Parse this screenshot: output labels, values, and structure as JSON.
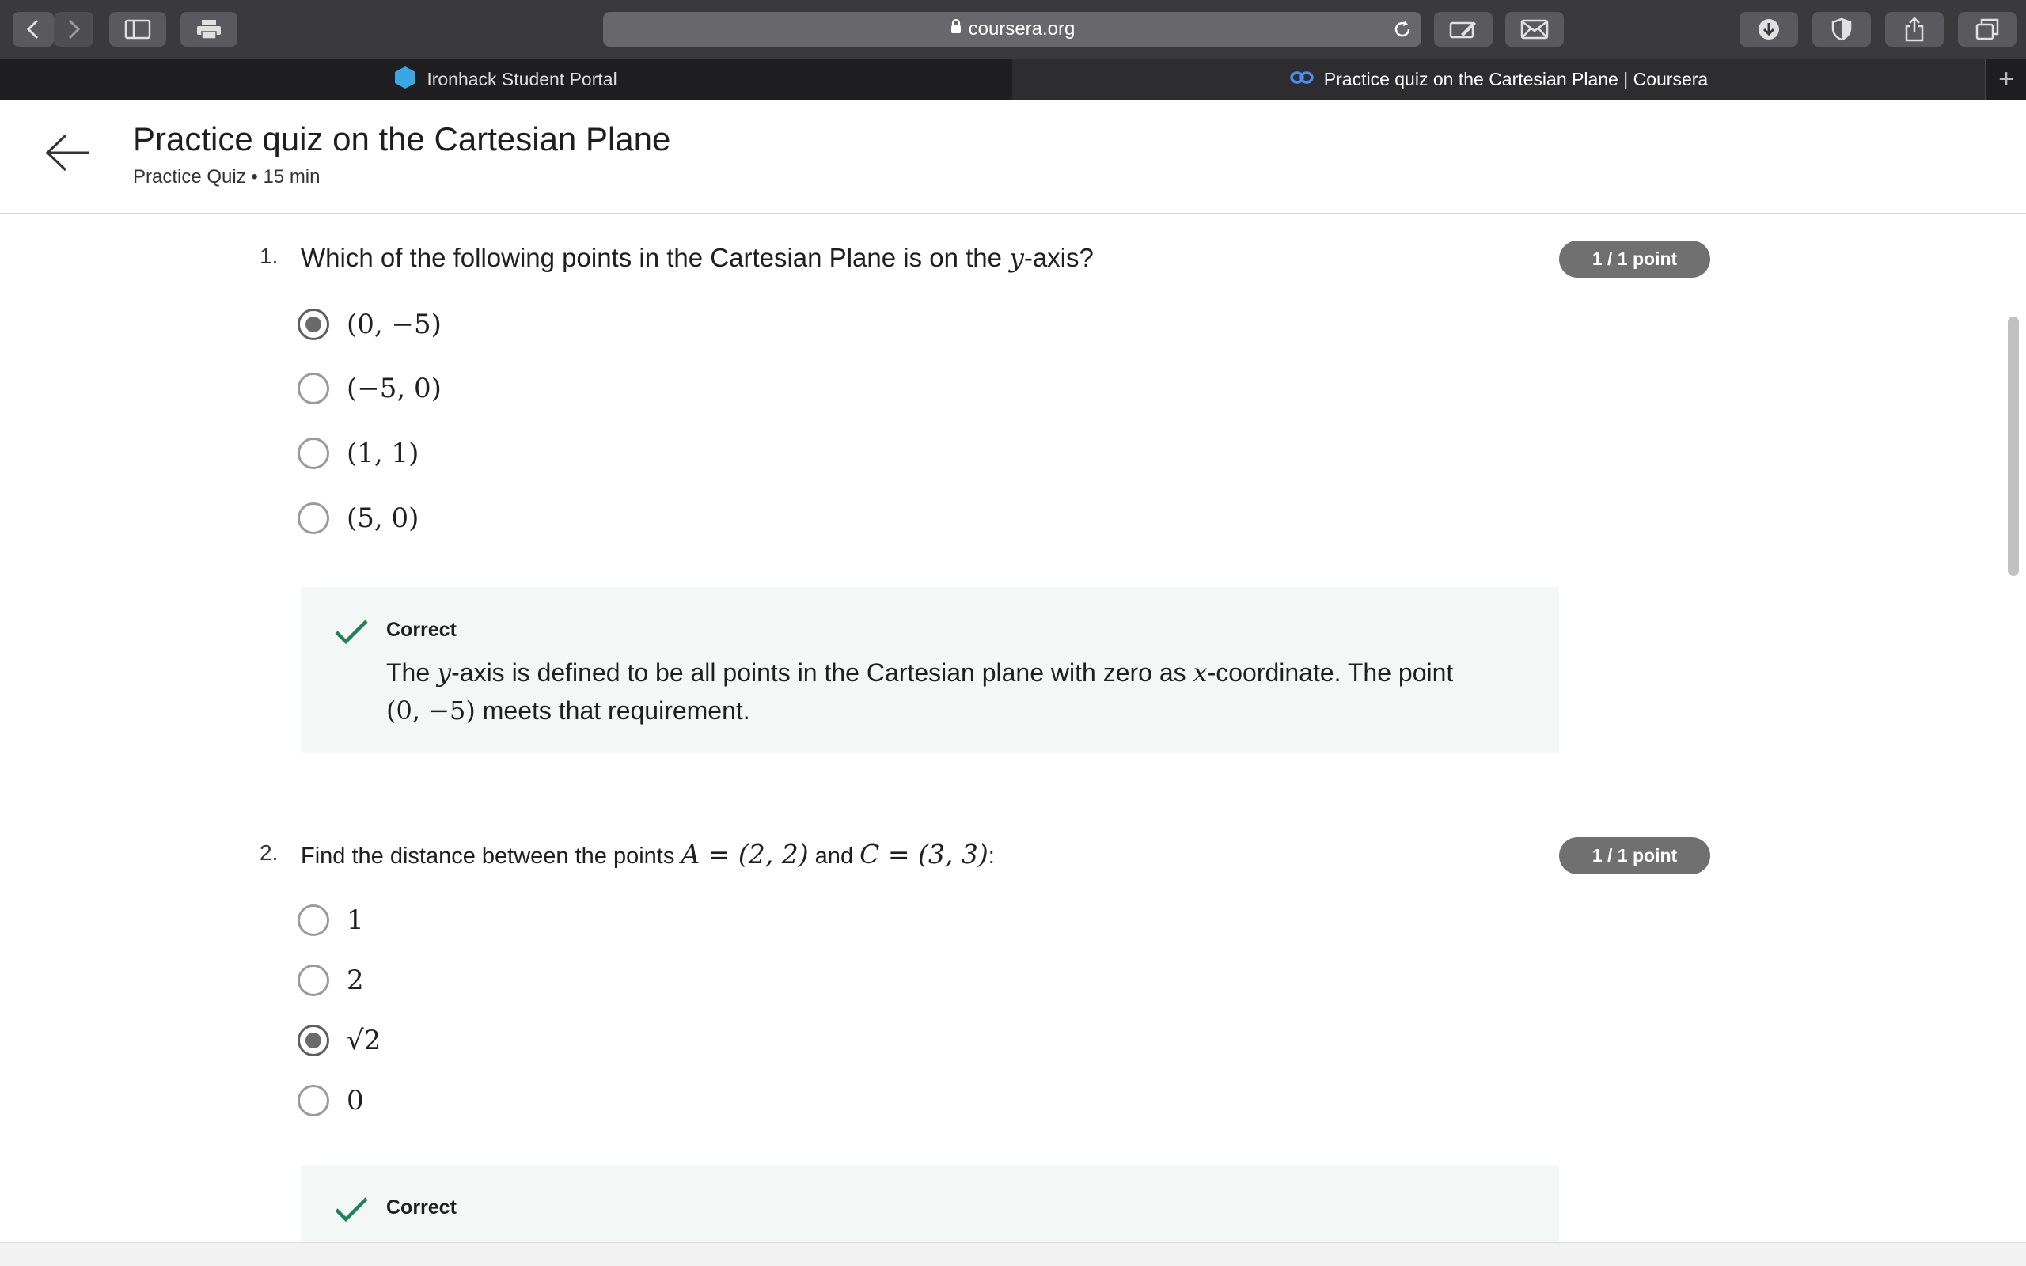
{
  "browser": {
    "url": "coursera.org",
    "tabs": [
      {
        "label": "Ironhack Student Portal",
        "active": false
      },
      {
        "label": "Practice quiz on the Cartesian Plane | Coursera",
        "active": true
      }
    ],
    "new_tab": "+"
  },
  "header": {
    "title": "Practice quiz on the Cartesian Plane",
    "subtitle": "Practice Quiz • 15 min"
  },
  "questions": [
    {
      "number": "1.",
      "text_before": "Which of the following points in the Cartesian Plane is on the ",
      "text_var": "y",
      "text_after": "-axis?",
      "points": "1 / 1 point",
      "options": [
        "(0, −5)",
        "(−5, 0)",
        "(1, 1)",
        "(5, 0)"
      ],
      "selected_index": 0,
      "feedback": {
        "title": "Correct",
        "line1_a": "The ",
        "line1_var1": "y",
        "line1_b": "-axis is defined to be all points in the Cartesian plane with zero as ",
        "line1_var2": "x",
        "line1_c": "-coordinate. The point",
        "line2_math": "(0, −5)",
        "line2_text": " meets that requirement."
      }
    },
    {
      "number": "2.",
      "text_a": "Find the distance between the points ",
      "text_m1": "A = (2, 2)",
      "text_b": " and ",
      "text_m2": "C = (3, 3)",
      "text_c": ":",
      "points": "1 / 1 point",
      "options": [
        "1",
        "2",
        "√2",
        "0"
      ],
      "selected_index": 2,
      "feedback": {
        "title": "Correct"
      }
    }
  ],
  "colors": {
    "toolbar": "#3a3a3c",
    "badge": "#707070",
    "feedback_bg": "#f3f8f6",
    "check": "#1f8354"
  }
}
